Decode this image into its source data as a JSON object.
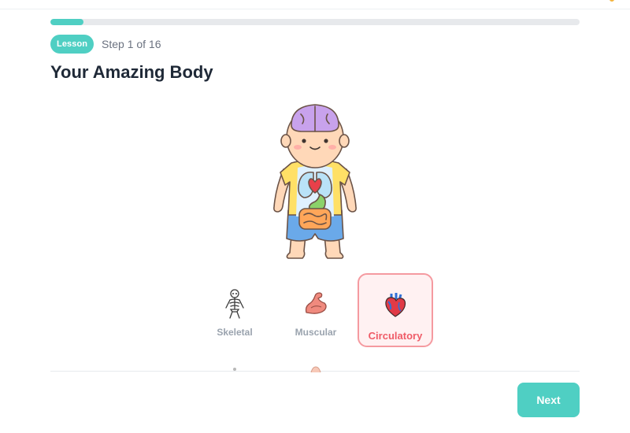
{
  "progress": {
    "current_step": 1,
    "total_steps": 16,
    "fraction": 0.0625
  },
  "lesson": {
    "badge": "Lesson",
    "step_text": "Step 1 of 16",
    "title": "Your Amazing Body"
  },
  "illustration": {
    "icon": "child-body-anatomy-illustration"
  },
  "systems": [
    {
      "label": "Skeletal",
      "icon": "skeleton-icon",
      "selected": false
    },
    {
      "label": "Muscular",
      "icon": "flexed-bicep-icon",
      "selected": false
    },
    {
      "label": "Circulatory",
      "icon": "heart-icon",
      "selected": true
    }
  ],
  "footer": {
    "next_label": "Next"
  },
  "colors": {
    "accent": "#4fcfc3",
    "selected_border": "#f59aa0",
    "selected_text": "#ef5b67",
    "muted_text": "#9aa3ae"
  }
}
